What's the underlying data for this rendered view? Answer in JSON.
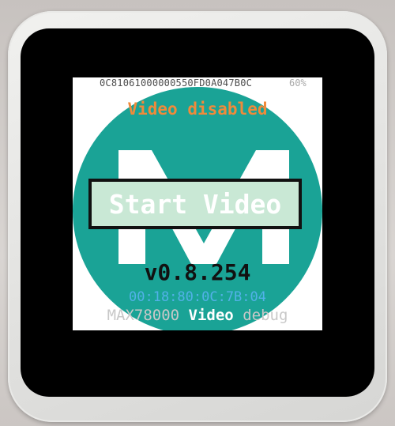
{
  "screen": {
    "device_id": "0C81061000000550FD0A047B0C",
    "battery": "60%",
    "status": "Video disabled",
    "start_button": "Start Video",
    "version": "v0.8.254",
    "mac": "00:18:80:0C:7B:04",
    "footer": {
      "app_name": "MAX78000",
      "mode": "Video",
      "debug": "debug"
    },
    "colors": {
      "logo_teal": "#1aa396",
      "status_orange": "#f08a3a",
      "mac_blue": "#52b1e8",
      "button_fill": "#c9e8d5"
    },
    "icons": {
      "logo": "maxim-logo-icon"
    }
  }
}
